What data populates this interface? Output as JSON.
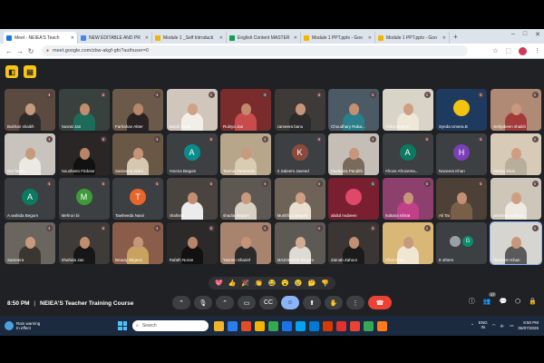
{
  "browser": {
    "tabs": [
      {
        "label": "Meet - NEIEA'S Teach",
        "color": "#1a73e8",
        "active": true
      },
      {
        "label": "NEW EDITABLE AND PR",
        "color": "#4285f4"
      },
      {
        "label": "Module 1 _Self Introducti",
        "color": "#f4b400"
      },
      {
        "label": "English Content MASTER",
        "color": "#0f9d58"
      },
      {
        "label": "Module 1 PPT.pptx - Goo",
        "color": "#f4b400"
      },
      {
        "label": "Module 1 PPT.pptx - Goo",
        "color": "#f4b400"
      }
    ],
    "new_tab": "+",
    "url": "meet.google.com/zbw-akgf-gfo?authuser=0"
  },
  "meet": {
    "participants": [
      {
        "name": "Bukhari shaikh",
        "type": "video",
        "bg": "#5b4a3f",
        "skin": "#c89a7d",
        "cloth": "#2d2a2a"
      },
      {
        "name": "Nusrat Jan",
        "type": "video",
        "bg": "#38413d",
        "skin": "#c28d6f",
        "cloth": "#1f6b5a"
      },
      {
        "name": "Farhahan Akter",
        "type": "video",
        "bg": "#6b5a4a",
        "skin": "#b98668",
        "cloth": "#2a2222"
      },
      {
        "name": "Bandi Swati",
        "type": "video",
        "bg": "#d0c6bc",
        "skin": "#d1a184",
        "cloth": "#f2efe8"
      },
      {
        "name": "Rukiya Jan",
        "type": "video",
        "bg": "#7a2b2b",
        "skin": "#bf8b6c",
        "cloth": "#c94b4b"
      },
      {
        "name": "zameera banu",
        "type": "video",
        "bg": "#3e3a38",
        "skin": "#c7957a",
        "cloth": "#2b2b2b"
      },
      {
        "name": "Choudhary Ruba...",
        "type": "video",
        "bg": "#4c5a66",
        "skin": "#c48f72",
        "cloth": "#2a7f8a"
      },
      {
        "name": "Afsha Begum",
        "type": "video",
        "bg": "#d8d4c8",
        "skin": "#cf9e82",
        "cloth": "#efe8d9"
      },
      {
        "name": "Syeda Umera.B",
        "type": "logo",
        "bg": "#1f3a5f",
        "skin": "#f1c40f",
        "cloth": "#1f3a5f"
      },
      {
        "name": "mehjabeen shaikh",
        "type": "video",
        "bg": "#b08a74",
        "skin": "#c9987d",
        "cloth": "#a33a3a"
      },
      {
        "name": "Dar farida",
        "type": "video",
        "bg": "#c9c3bd",
        "skin": "#c89a7d",
        "cloth": "#ece8e2"
      },
      {
        "name": "Nousheen Firdose",
        "type": "video",
        "bg": "#2a2625",
        "skin": "#b88468",
        "cloth": "#111111"
      },
      {
        "name": "Sameena Wani",
        "type": "video",
        "bg": "#6a5846",
        "skin": "#c59376",
        "cloth": "#d6c8b0"
      },
      {
        "name": "Amena Begum",
        "type": "avatar",
        "initial": "A",
        "bg": "#3c4043",
        "color": "#0b8c8c"
      },
      {
        "name": "Tasmia Tarannum",
        "type": "video",
        "bg": "#b7a68a",
        "skin": "#c89a7d",
        "cloth": "#d9ccb0"
      },
      {
        "name": "K.Saleem Javeed",
        "type": "avatar",
        "initial": "K",
        "bg": "#3c4043",
        "color": "#8d4a3c"
      },
      {
        "name": "Mudasira Pandith",
        "type": "video",
        "bg": "#c4beb6",
        "skin": "#c8967a",
        "cloth": "#7a6a5c"
      },
      {
        "name": "Afroze Afrozema...",
        "type": "avatar",
        "initial": "A",
        "bg": "#3c4043",
        "color": "#0b7a61"
      },
      {
        "name": "Nazeera Khan",
        "type": "avatar",
        "initial": "H",
        "bg": "#3c4043",
        "color": "#7b3fb8"
      },
      {
        "name": "Nasiya khan",
        "type": "video",
        "bg": "#d7cbb8",
        "skin": "#cf9e82",
        "cloth": "#b9ad9b"
      },
      {
        "name": "A.wahida Begum",
        "type": "avatar",
        "initial": "A",
        "bg": "#3c4043",
        "color": "#0b7a61"
      },
      {
        "name": "Mehrun bi",
        "type": "avatar",
        "initial": "M",
        "bg": "#3c4043",
        "color": "#3f9b3a"
      },
      {
        "name": "Tawheeda Nasir",
        "type": "avatar",
        "initial": "T",
        "bg": "#3c4043",
        "color": "#e8652b"
      },
      {
        "name": "shahista",
        "type": "video",
        "bg": "#4a4441",
        "skin": "#c28f72",
        "cloth": "#ececec"
      },
      {
        "name": "shadia Begum",
        "type": "video",
        "bg": "#5e5852",
        "skin": "#c89a7d",
        "cloth": "#d9d0c4"
      },
      {
        "name": "Mushfiqa Begum",
        "type": "video",
        "bg": "#6f6358",
        "skin": "#cf9e82",
        "cloth": "#e9dfd1"
      },
      {
        "name": "abdul mubeen",
        "type": "logo",
        "bg": "#7a1f2f",
        "skin": "#e0486a",
        "cloth": "#7a1f2f"
      },
      {
        "name": "Sultana Ishrat",
        "type": "video",
        "bg": "#8d3f6d",
        "skin": "#c8967a",
        "cloth": "#c2408a"
      },
      {
        "name": "Ali Tai",
        "type": "video",
        "bg": "#4d4036",
        "skin": "#c48f72",
        "cloth": "#7a5f48"
      },
      {
        "name": "yasmeen sultana",
        "type": "video",
        "bg": "#cfc6ba",
        "skin": "#cf9e82",
        "cloth": "#eeeae2"
      },
      {
        "name": "Sameera",
        "type": "video",
        "bg": "#6a665f",
        "skin": "#c89a7d",
        "cloth": "#3a3632"
      },
      {
        "name": "Shahida Jan",
        "type": "video",
        "bg": "#3f3b38",
        "skin": "#c28d6f",
        "cloth": "#161616"
      },
      {
        "name": "Beauty Bilgees",
        "type": "video",
        "bg": "#8a5c4a",
        "skin": "#c7957a",
        "cloth": "#c9a25f"
      },
      {
        "name": "Rafath Noran",
        "type": "video",
        "bg": "#2b2a29",
        "skin": "#b88468",
        "cloth": "#111111"
      },
      {
        "name": "Yasmin Sharief",
        "type": "video",
        "bg": "#a8836e",
        "skin": "#c59376",
        "cloth": "#2b2b2b"
      },
      {
        "name": "MAZAHEER Begum",
        "type": "video",
        "bg": "#5d5a56",
        "skin": "#d4aa92",
        "cloth": "#dedad4"
      },
      {
        "name": "Zainab Zahoor",
        "type": "video",
        "bg": "#3b3633",
        "skin": "#c28f72",
        "cloth": "#1b1b1b"
      },
      {
        "name": "Afroz Khan",
        "type": "video",
        "bg": "#d9b776",
        "skin": "#c89a7d",
        "cloth": "#f0e6d2"
      },
      {
        "name": "8 others",
        "type": "others",
        "bg": "#3c4043"
      },
      {
        "name": "Tasneem Khan",
        "type": "self",
        "bg": "#d7d5d0",
        "skin": "#c8967a",
        "cloth": "#5a5a5a"
      }
    ],
    "others_avatars": [
      {
        "initial": "",
        "color": "#9aa0a6"
      },
      {
        "initial": "G",
        "color": "#0b8c6b"
      }
    ],
    "reactions": [
      "💖",
      "👍",
      "🎉",
      "👏",
      "😂",
      "😮",
      "😢",
      "🤔",
      "👎"
    ],
    "time": "8:50 PM",
    "meeting_title": "NEIEA'S Teacher Training Course",
    "people_count": "47"
  },
  "taskbar": {
    "weather_title": "Rain warning",
    "weather_sub": "In effect",
    "search_placeholder": "Search",
    "apps": [
      "#f0b429",
      "#2b7de9",
      "#e34c26",
      "#f4b400",
      "#34a853",
      "#1a73e8",
      "#00a4ef",
      "#0078d4",
      "#d83b01",
      "#e3312e",
      "#ea4335",
      "#34a853",
      "#ff7a1a"
    ],
    "lang_1": "ENG",
    "lang_2": "IN",
    "clock_time": "8:50 PM",
    "clock_date": "06/07/2025"
  }
}
